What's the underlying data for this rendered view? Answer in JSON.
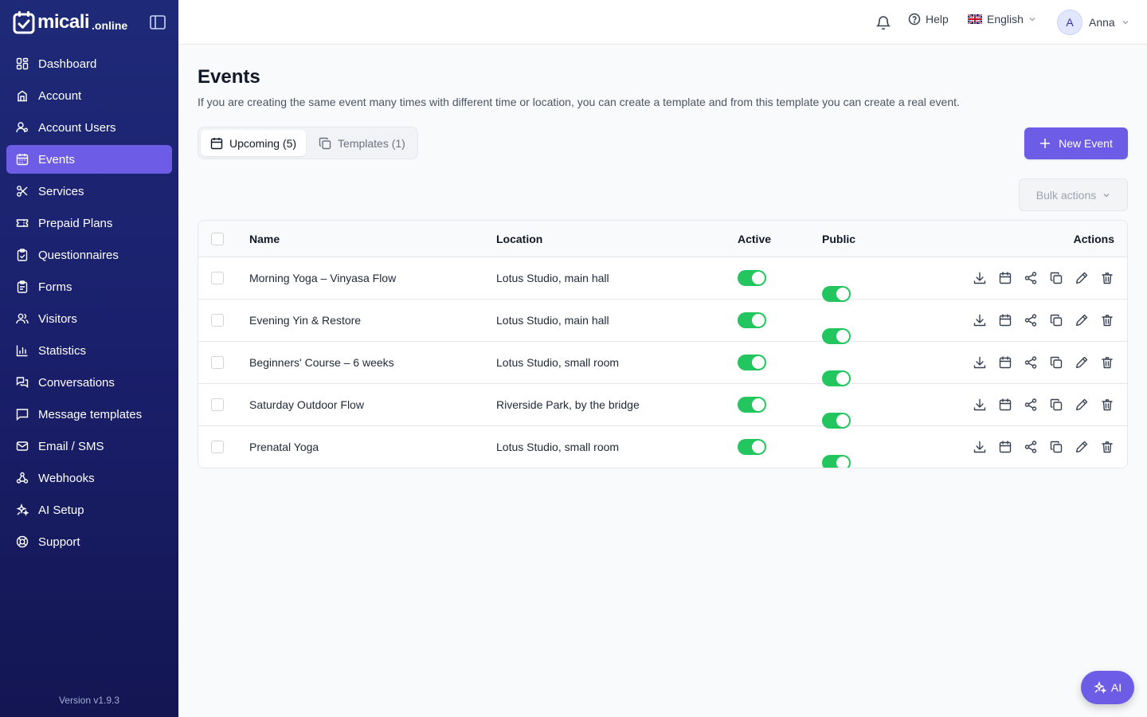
{
  "app": {
    "logo_text": "micali",
    "logo_sub": ".online",
    "version": "Version v1.9.3"
  },
  "sidebar": {
    "items": [
      {
        "label": "Dashboard",
        "icon": "dashboard-icon"
      },
      {
        "label": "Account",
        "icon": "building-icon"
      },
      {
        "label": "Account Users",
        "icon": "users-cog-icon"
      },
      {
        "label": "Events",
        "icon": "calendar-icon",
        "active": true
      },
      {
        "label": "Services",
        "icon": "scissors-icon"
      },
      {
        "label": "Prepaid Plans",
        "icon": "ticket-icon"
      },
      {
        "label": "Questionnaires",
        "icon": "clipboard-icon"
      },
      {
        "label": "Forms",
        "icon": "form-icon"
      },
      {
        "label": "Visitors",
        "icon": "visitors-icon"
      },
      {
        "label": "Statistics",
        "icon": "chart-icon"
      },
      {
        "label": "Conversations",
        "icon": "conversation-icon"
      },
      {
        "label": "Message templates",
        "icon": "message-icon"
      },
      {
        "label": "Email / SMS",
        "icon": "mail-icon"
      },
      {
        "label": "Webhooks",
        "icon": "webhook-icon"
      },
      {
        "label": "AI Setup",
        "icon": "sparkles-icon"
      },
      {
        "label": "Support",
        "icon": "lifebuoy-icon"
      }
    ]
  },
  "topbar": {
    "help": "Help",
    "language": "English",
    "user_initial": "A",
    "user_name": "Anna"
  },
  "page": {
    "title": "Events",
    "description": "If you are creating the same event many times with different time or location, you can create a template and from this template you can create a real event.",
    "tabs": [
      {
        "label": "Upcoming (5)",
        "active": true
      },
      {
        "label": "Templates (1)",
        "active": false
      }
    ],
    "new_button": "New Event",
    "bulk_actions": "Bulk actions"
  },
  "table": {
    "columns": {
      "name": "Name",
      "location": "Location",
      "active": "Active",
      "public": "Public",
      "actions": "Actions"
    },
    "rows": [
      {
        "name": "Morning Yoga – Vinyasa Flow",
        "location": "Lotus Studio, main hall",
        "active": true,
        "public": true
      },
      {
        "name": "Evening Yin & Restore",
        "location": "Lotus Studio, main hall",
        "active": true,
        "public": true
      },
      {
        "name": "Beginners' Course – 6 weeks",
        "location": "Lotus Studio, small room",
        "active": true,
        "public": true
      },
      {
        "name": "Saturday Outdoor Flow",
        "location": "Riverside Park, by the bridge",
        "active": true,
        "public": true
      },
      {
        "name": "Prenatal Yoga",
        "location": "Lotus Studio, small room",
        "active": true,
        "public": true
      }
    ],
    "row_actions": [
      "download-icon",
      "calendar-icon",
      "share-icon",
      "copy-icon",
      "edit-icon",
      "trash-icon"
    ]
  },
  "ai_button": "AI",
  "colors": {
    "sidebar": "#1e2a78",
    "accent": "#6d5ce6",
    "toggle_on": "#22c55e"
  }
}
